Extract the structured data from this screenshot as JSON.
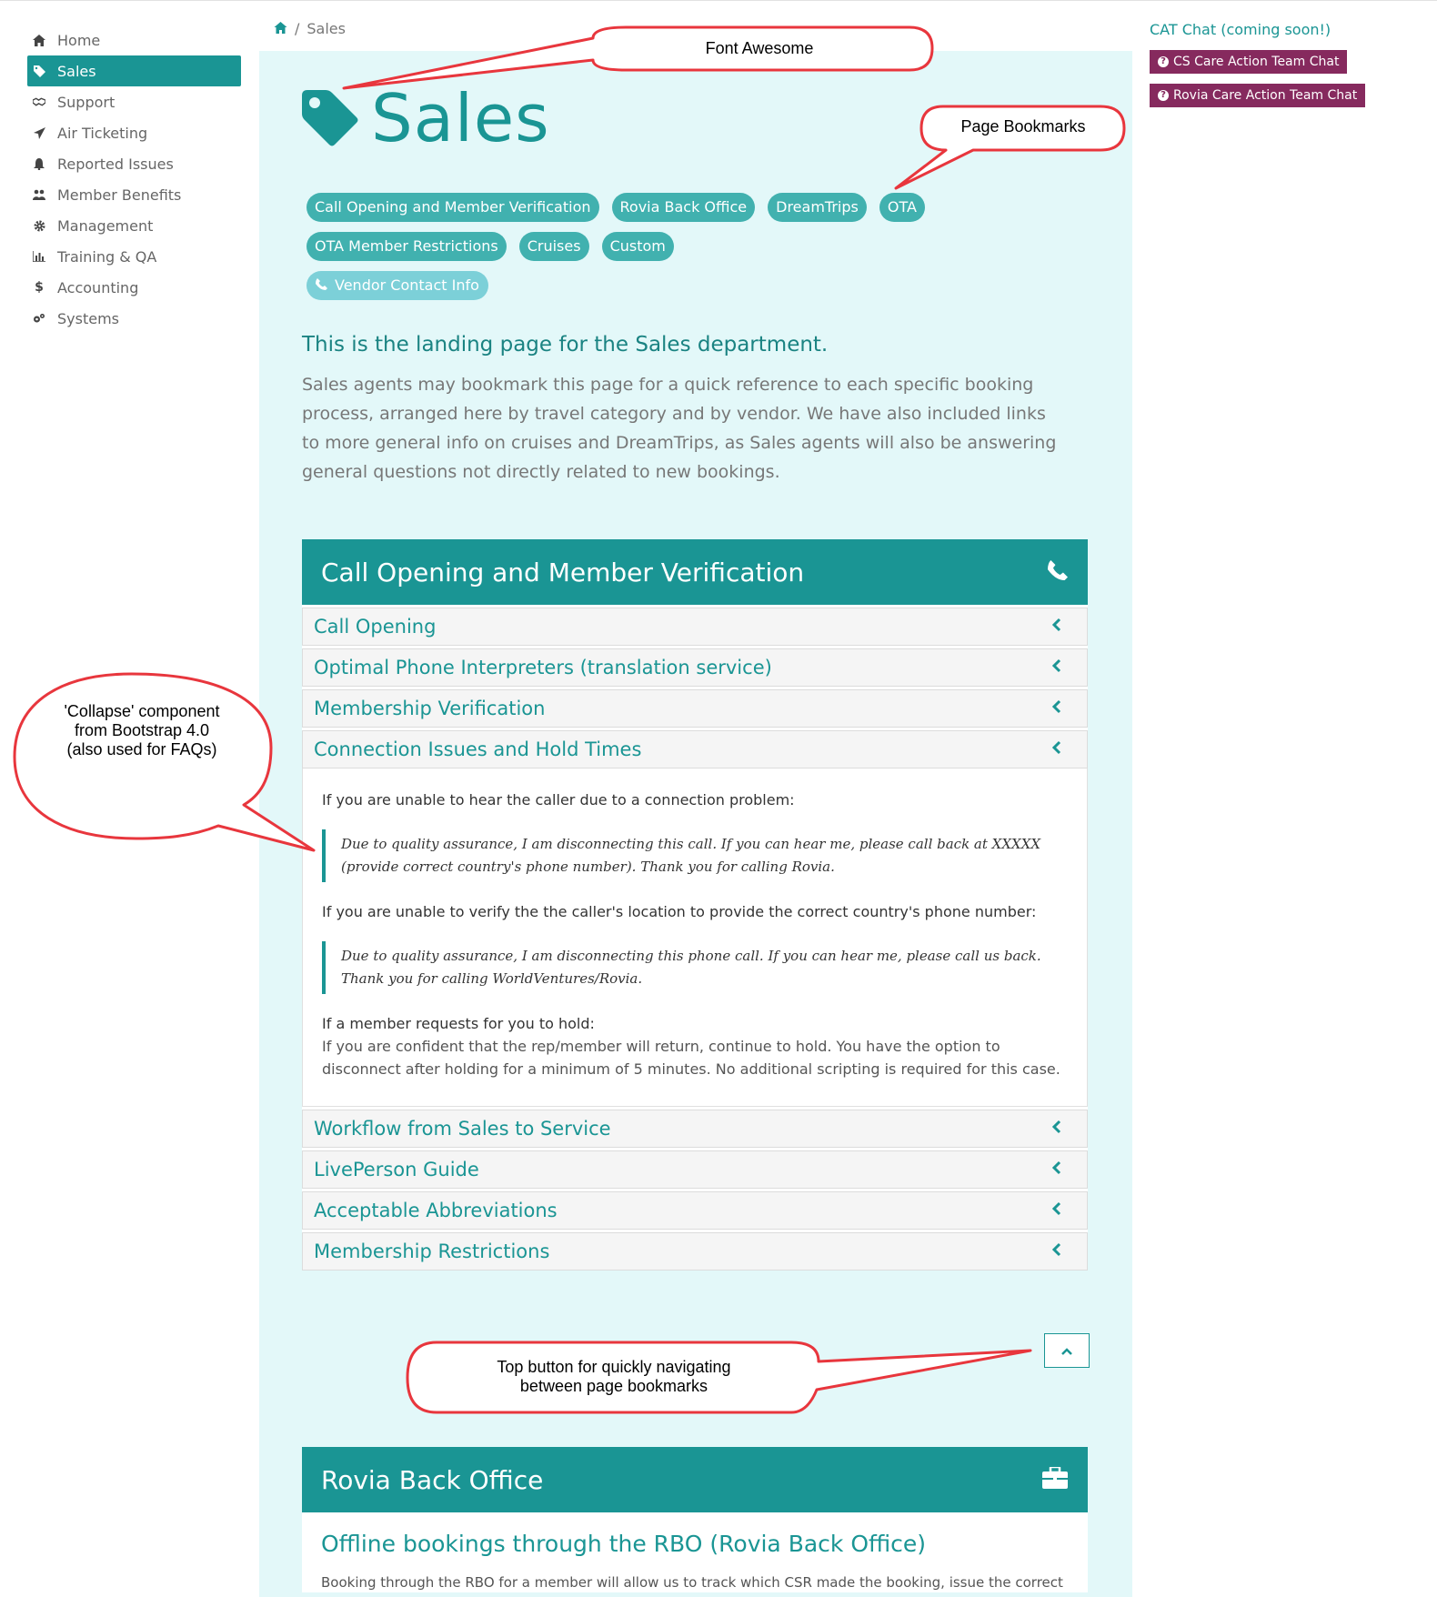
{
  "sidebar": {
    "items": [
      {
        "label": "Home",
        "icon": "home-icon"
      },
      {
        "label": "Sales",
        "icon": "tag-icon",
        "active": true
      },
      {
        "label": "Support",
        "icon": "handshake-icon"
      },
      {
        "label": "Air Ticketing",
        "icon": "plane-icon"
      },
      {
        "label": "Reported Issues",
        "icon": "bell-icon"
      },
      {
        "label": "Member Benefits",
        "icon": "users-icon"
      },
      {
        "label": "Management",
        "icon": "gear-icon"
      },
      {
        "label": "Training & QA",
        "icon": "bar-chart-icon"
      },
      {
        "label": "Accounting",
        "icon": "dollar-icon"
      },
      {
        "label": "Systems",
        "icon": "gears-icon"
      }
    ]
  },
  "breadcrumb": {
    "separator": "/",
    "current": "Sales"
  },
  "page": {
    "title": "Sales",
    "bookmarks_row1": [
      "Call Opening and Member Verification",
      "Rovia Back Office",
      "DreamTrips",
      "OTA"
    ],
    "bookmarks_row2": [
      "OTA Member Restrictions",
      "Cruises",
      "Custom"
    ],
    "bookmark_vendor": "Vendor Contact Info",
    "lead": "This is the landing page for the Sales department.",
    "intro": "Sales agents may bookmark this page for a quick reference to each specific booking process, arranged here by travel category and by vendor. We have also included links to more general info on cruises and DreamTrips, as Sales agents will also be answering general questions not directly related to new bookings."
  },
  "card1": {
    "title": "Call Opening and Member Verification",
    "items_before": [
      "Call Opening",
      "Optimal Phone Interpreters (translation service)",
      "Membership Verification",
      "Connection Issues and Hold Times"
    ],
    "body": {
      "p1": "If you are unable to hear the caller due to a connection problem:",
      "q1": "Due to quality assurance, I am disconnecting this call. If you can hear me, please call back at XXXXX (provide correct country's phone number). Thank you for calling Rovia.",
      "p2": "If you are unable to verify the the caller's location to provide the correct country's phone number:",
      "q2": "Due to quality assurance, I am disconnecting this phone call. If you can hear me, please call us back. Thank you for calling WorldVentures/Rovia.",
      "p3_title": "If a member requests for you to hold:",
      "p3_body": "If you are confident that the rep/member will return, continue to hold. You have the option to disconnect after holding for a minimum of 5 minutes. No additional scripting is required for this case."
    },
    "items_after": [
      "Workflow from Sales to Service",
      "LivePerson Guide",
      "Acceptable Abbreviations",
      "Membership Restrictions"
    ]
  },
  "card2": {
    "title": "Rovia Back Office",
    "subtitle": "Offline bookings through the RBO (Rovia Back Office)",
    "text": "Booking through the RBO for a member will allow us to track which CSR made the booking, issue the correct"
  },
  "right": {
    "cat_title": "CAT Chat (coming soon!)",
    "btn1": "CS Care Action Team Chat",
    "btn2": "Rovia Care Action Team Chat"
  },
  "callouts": {
    "font_awesome": "Font Awesome",
    "bookmarks": "Page Bookmarks",
    "collapse_l1": "'Collapse' component",
    "collapse_l2": "from Bootstrap 4.0",
    "collapse_l3": "(also used for FAQs)",
    "top_l1": "Top button for quickly navigating",
    "top_l2": "between page bookmarks"
  },
  "colors": {
    "accent": "#1a9594",
    "panel": "#e3f8f9",
    "chat": "#862a5e",
    "callout": "#e8363d"
  }
}
